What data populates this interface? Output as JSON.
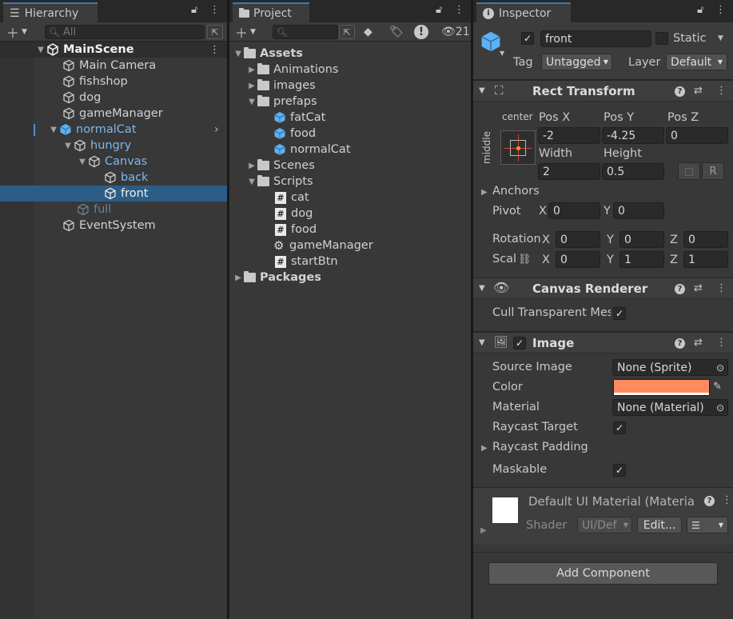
{
  "hierarchy": {
    "tab_label": "Hierarchy",
    "search_placeholder": "All",
    "scene": "MainScene",
    "items": [
      {
        "label": "Main Camera"
      },
      {
        "label": "fishshop"
      },
      {
        "label": "dog"
      },
      {
        "label": "gameManager"
      },
      {
        "label": "normalCat"
      },
      {
        "label": "hungry"
      },
      {
        "label": "Canvas"
      },
      {
        "label": "back"
      },
      {
        "label": "front"
      },
      {
        "label": "full"
      },
      {
        "label": "EventSystem"
      }
    ]
  },
  "project": {
    "tab_label": "Project",
    "hidden_count": "21",
    "root": "Assets",
    "items": [
      {
        "label": "Animations"
      },
      {
        "label": "images"
      },
      {
        "label": "prefaps"
      },
      {
        "label": "fatCat"
      },
      {
        "label": "food"
      },
      {
        "label": "normalCat"
      },
      {
        "label": "Scenes"
      },
      {
        "label": "Scripts"
      },
      {
        "label": "cat"
      },
      {
        "label": "dog"
      },
      {
        "label": "food"
      },
      {
        "label": "gameManager"
      },
      {
        "label": "startBtn"
      }
    ],
    "packages": "Packages"
  },
  "inspector": {
    "tab_label": "Inspector",
    "object_name": "front",
    "static_label": "Static",
    "tag_label": "Tag",
    "tag_value": "Untagged",
    "layer_label": "Layer",
    "layer_value": "Default",
    "rect_transform": {
      "title": "Rect Transform",
      "anchor_h": "center",
      "anchor_v": "middle",
      "posx_label": "Pos X",
      "posx": "-2",
      "posy_label": "Pos Y",
      "posy": "-4.25",
      "posz_label": "Pos Z",
      "posz": "0",
      "width_label": "Width",
      "width": "2",
      "height_label": "Height",
      "height": "0.5",
      "r_label": "R",
      "anchors_label": "Anchors",
      "pivot_label": "Pivot",
      "x_label": "X",
      "y_label": "Y",
      "z_label": "Z",
      "pivot_x": "0",
      "pivot_y": "0",
      "rotation_label": "Rotation",
      "rot_x": "0",
      "rot_y": "0",
      "rot_z": "0",
      "scale_label": "Scal",
      "scale_x": "0",
      "scale_y": "1",
      "scale_z": "1"
    },
    "canvas_renderer": {
      "title": "Canvas Renderer",
      "cull_label": "Cull Transparent Mes"
    },
    "image": {
      "title": "Image",
      "source_label": "Source Image",
      "source_value": "None (Sprite)",
      "color_label": "Color",
      "color_value": "#ff8a5e",
      "material_label": "Material",
      "material_value": "None (Material)",
      "raycast_label": "Raycast Target",
      "raycast_padding_label": "Raycast Padding",
      "maskable_label": "Maskable"
    },
    "material": {
      "title": "Default UI Material (Materia",
      "shader_label": "Shader",
      "shader_value": "UI/Def",
      "edit_label": "Edit..."
    },
    "add_component": "Add Component"
  }
}
